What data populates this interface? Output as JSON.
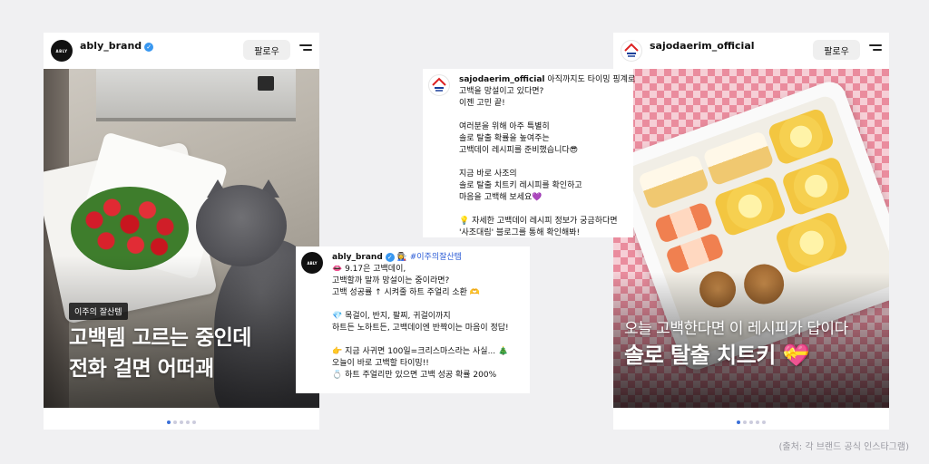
{
  "ably_post": {
    "username": "ably_brand",
    "avatar_text": "ABLY",
    "follow_label": "팔로우",
    "tag": "이주의 잘산템",
    "title_line1": "고백템 고르는 중인데",
    "title_line2": "전화 걸면 어떠괘",
    "pager": {
      "count": 5,
      "active": 0
    }
  },
  "sajo_post": {
    "username": "sajodaerim_official",
    "avatar_text": "SAJO",
    "follow_label": "팔로우",
    "subtitle": "오늘 고백한다면 이 레시피가 답이다",
    "title": "솔로 탈출 치트키 💝",
    "pager": {
      "count": 5,
      "active": 0
    }
  },
  "sajo_caption": {
    "username": "sajodaerim_official",
    "first_line": "아직까지도 타이밍 핑계로",
    "lines": [
      "고백을 망설이고 있다면?",
      "이젠 고민 끝!",
      "",
      "여러분을 위해 아주 특별히",
      "솔로 탈출 확률을 높여주는",
      "고백데이 레시피를 준비했습니다😎",
      "",
      "지금 바로 사조의",
      "솔로 탈출 치트키 레시피를 확인하고",
      "마음을 고백해 보세요💜",
      "",
      "💡 자세한 고백데이 레시피 정보가 궁금하다면",
      "'사조대림' 블로그를 통해 확인해봐!"
    ]
  },
  "ably_caption": {
    "username": "ably_brand",
    "hashtag": "👩‍🏭 #이주의잘산템",
    "lines": [
      "👄 9.17은 고백데이,",
      "고백할까 말까 망설이는 중이라면?",
      "고백 성공률 ↑ 시켜줄 하트 주얼리 소환 🫶",
      "",
      "💎 목걸이, 반지, 팔찌, 귀걸이까지",
      "하트든 노하트든, 고백데이엔 반짝이는 마음이 정답!",
      "",
      "👉 지금 사귀면 100일=크리스마스라는 사실... 🎄",
      "오늘이 바로 고백할 타이밍!!",
      "💍 하트 주얼리만 있으면 고백 성공 확률 200%"
    ]
  },
  "source_note": "(출처: 각 브랜드 공식 인스타그램)"
}
